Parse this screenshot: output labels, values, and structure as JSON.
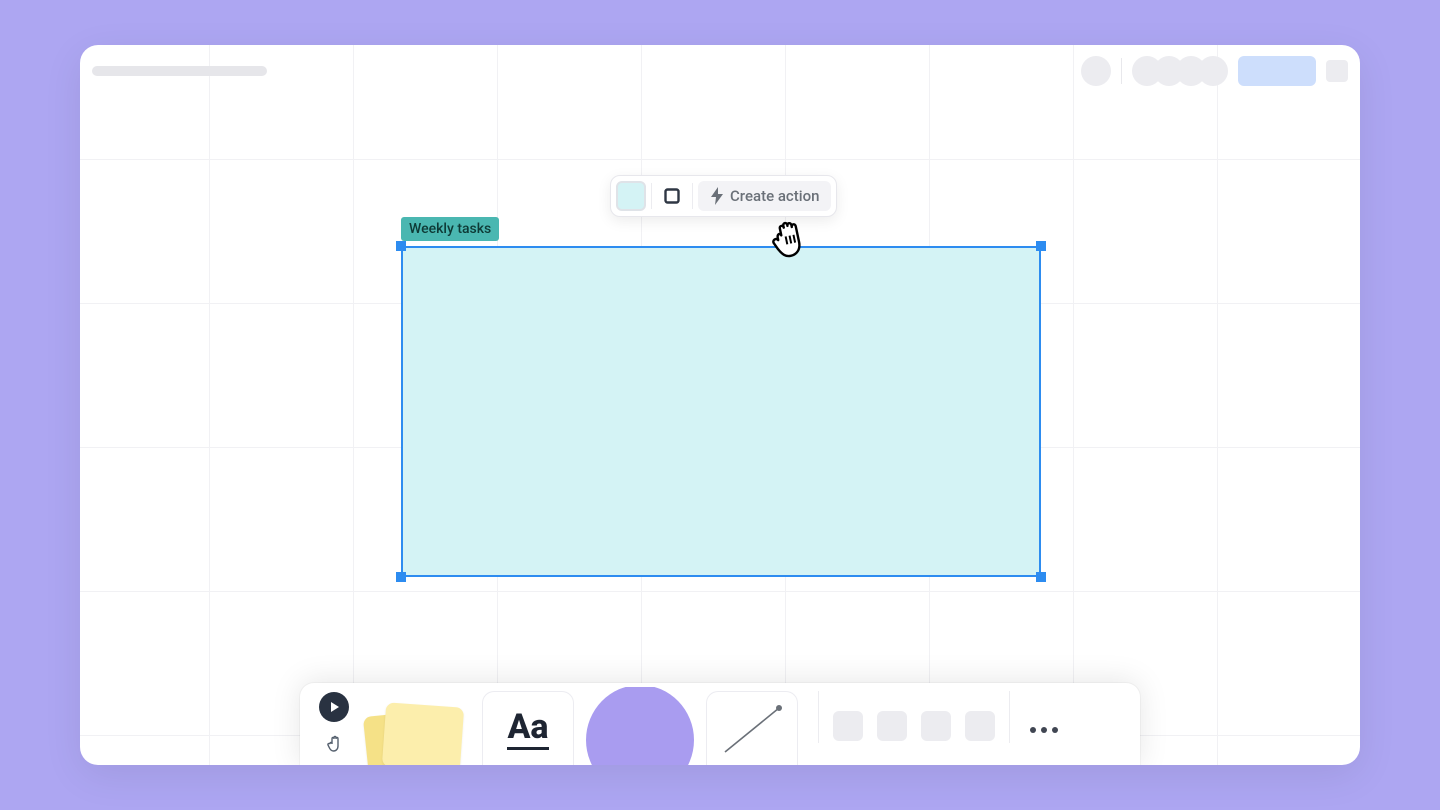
{
  "selection": {
    "tag_label": "Weekly tasks"
  },
  "context_toolbar": {
    "create_action_label": "Create action"
  },
  "toolbox": {
    "text_tool_label": "Aa"
  }
}
